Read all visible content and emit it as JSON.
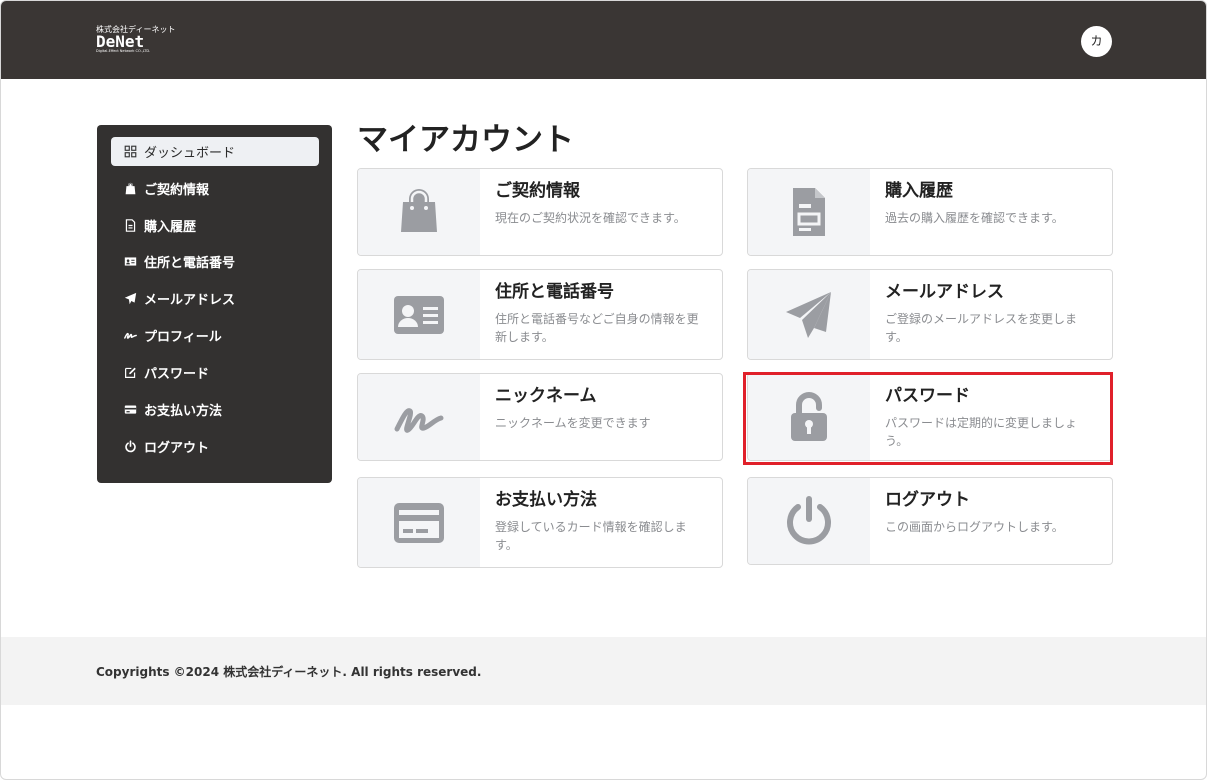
{
  "header": {
    "logo_company": "株式会社ディーネット",
    "logo_word": "DeNet",
    "logo_tagline": "Digital-Effect Network CO.,LTD.",
    "avatar_initial": "カ"
  },
  "sidebar": {
    "items": [
      {
        "label": "ダッシュボード",
        "icon": "dashboard-icon",
        "active": true
      },
      {
        "label": "ご契約情報",
        "icon": "shopping-bag-icon"
      },
      {
        "label": "購入履歴",
        "icon": "document-icon"
      },
      {
        "label": "住所と電話番号",
        "icon": "id-card-icon"
      },
      {
        "label": "メールアドレス",
        "icon": "paper-plane-icon"
      },
      {
        "label": "プロフィール",
        "icon": "signature-icon"
      },
      {
        "label": "パスワード",
        "icon": "edit-icon"
      },
      {
        "label": "お支払い方法",
        "icon": "credit-card-icon"
      },
      {
        "label": "ログアウト",
        "icon": "power-icon"
      }
    ]
  },
  "main": {
    "title": "マイアカウント",
    "cards": [
      {
        "title": "ご契約情報",
        "desc": "現在のご契約状況を確認できます。",
        "icon": "shopping-bag-icon"
      },
      {
        "title": "購入履歴",
        "desc": "過去の購入履歴を確認できます。",
        "icon": "document-icon"
      },
      {
        "title": "住所と電話番号",
        "desc": "住所と電話番号などご自身の情報を更新します。",
        "icon": "id-card-icon"
      },
      {
        "title": "メールアドレス",
        "desc": "ご登録のメールアドレスを変更します。",
        "icon": "paper-plane-icon"
      },
      {
        "title": "ニックネーム",
        "desc": "ニックネームを変更できます",
        "icon": "signature-icon"
      },
      {
        "title": "パスワード",
        "desc": "パスワードは定期的に変更しましょう。",
        "icon": "unlock-icon"
      },
      {
        "title": "お支払い方法",
        "desc": "登録しているカード情報を確認します。",
        "icon": "credit-card-icon"
      },
      {
        "title": "ログアウト",
        "desc": "この画面からログアウトします。",
        "icon": "power-icon"
      }
    ]
  },
  "footer": {
    "copyright": "Copyrights ©2024 株式会社ディーネット. All rights reserved."
  },
  "colors": {
    "header_bg": "#3a3634",
    "sidebar_bg": "#333130",
    "icon_gray": "#9b9da2",
    "highlight": "#e0202a"
  }
}
